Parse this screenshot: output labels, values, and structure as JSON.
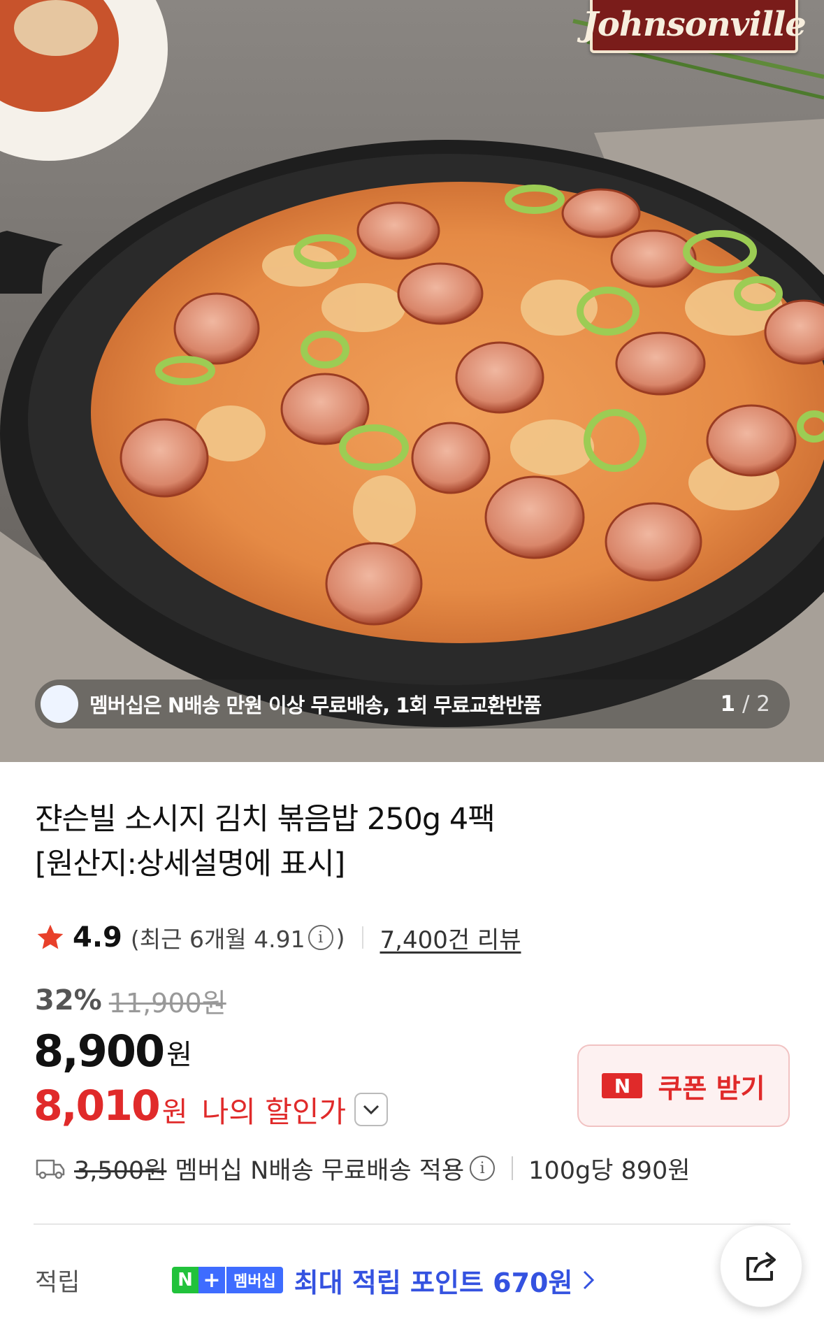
{
  "hero": {
    "brand_logo_text": "Johnsonville",
    "notice_text": "멤버십은 N배송 만원 이상 무료배송, 1회 무료교환반품",
    "pager_current": "1",
    "pager_separator": "/",
    "pager_total": "2"
  },
  "product": {
    "title_line1": "쟌슨빌 소시지 김치 볶음밥 250g 4팩",
    "title_line2": "[원산지:상세설명에 표시]"
  },
  "rating": {
    "score": "4.9",
    "recent_prefix": "(최근 6개월 4.91",
    "recent_suffix": ")",
    "info_icon_glyph": "i",
    "review_count": "7,400건 리뷰",
    "star_color": "#e8402a"
  },
  "pricing": {
    "discount_rate": "32%",
    "original_price": "11,900원",
    "price": "8,900",
    "price_unit": "원",
    "my_price": "8,010",
    "my_price_unit": "원",
    "my_price_label": "나의 할인가",
    "accent_red": "#e02a2a"
  },
  "coupon": {
    "badge": "N",
    "label": "쿠폰 받기"
  },
  "shipping": {
    "fee": "3,500원",
    "text": "멤버십 N배송 무료배송 적용",
    "info_icon_glyph": "i",
    "unit_price": "100g당 890원"
  },
  "points": {
    "label": "적립",
    "badge_n": "N",
    "badge_plus": "+",
    "badge_text": "멤버십",
    "text": "최대 적립 포인트 670원",
    "accent_blue": "#3452e0"
  },
  "icons": {
    "star": "star-icon",
    "truck": "truck-icon",
    "share": "share-icon",
    "chevron_down": "chevron-down-icon",
    "chevron_right": "chevron-right-icon"
  }
}
